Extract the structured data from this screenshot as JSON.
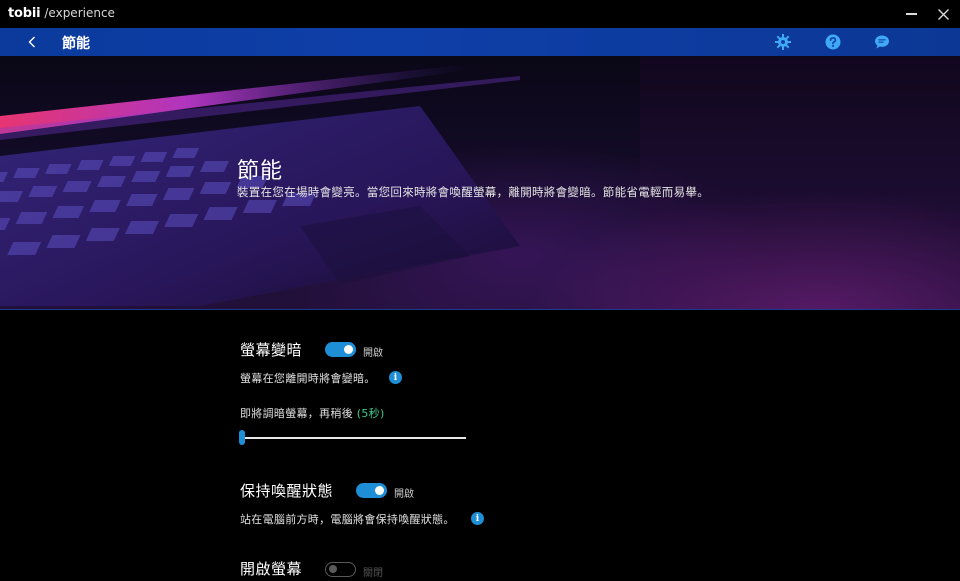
{
  "app": {
    "brand": "tobii",
    "subtitle": "/experience"
  },
  "nav": {
    "title": "節能",
    "icons": [
      "back-chevron-icon",
      "gear-icon",
      "help-icon",
      "chat-icon"
    ]
  },
  "hero": {
    "title": "節能",
    "description": "裝置在您在場時會變亮。當您回來時將會喚醒螢幕，離開時將會變暗。節能省電輕而易舉。"
  },
  "settings": {
    "dim_screen": {
      "title": "螢幕變暗",
      "state": "開啟",
      "on": true,
      "description": "螢幕在您離開時將會變暗。",
      "slider_text": "即將調暗螢幕，再稍後",
      "slider_value": "(5秒)",
      "slider_fraction": 0.0
    },
    "stay_awake": {
      "title": "保持喚醒狀態",
      "state": "開啟",
      "on": true,
      "description": "站在電腦前方時，電腦將會保持喚醒狀態。"
    },
    "wake_screen": {
      "title": "開啟螢幕",
      "state": "關閉",
      "on": false
    }
  },
  "colors": {
    "accent": "#1e8fd6",
    "nav_bar": "#0e3fa8",
    "slider_value": "#3ec98a"
  }
}
